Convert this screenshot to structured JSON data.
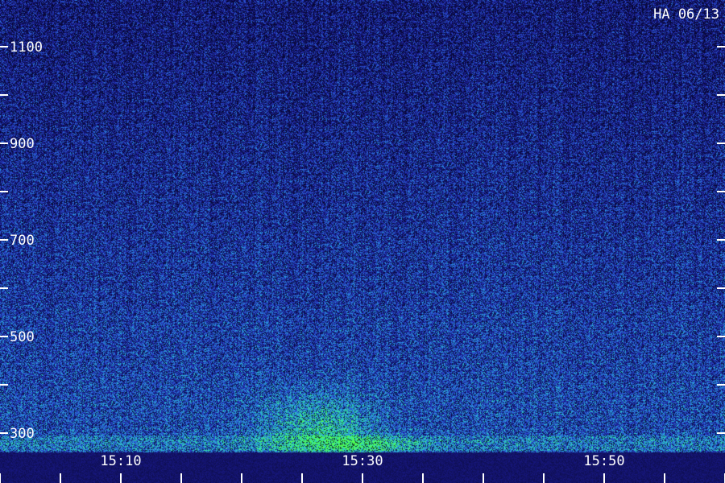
{
  "chart_data": {
    "type": "heatmap",
    "title": "HA 06/13",
    "yticks": [
      {
        "value": 300,
        "label": "300"
      },
      {
        "value": 500,
        "label": "500"
      },
      {
        "value": 700,
        "label": "700"
      },
      {
        "value": 900,
        "label": "900"
      },
      {
        "value": 1100,
        "label": "1100"
      }
    ],
    "yminor": [
      400,
      600,
      800,
      1000
    ],
    "xticks": [
      {
        "value": "15:10",
        "label": "15:10"
      },
      {
        "value": "15:30",
        "label": "15:30"
      },
      {
        "value": "15:50",
        "label": "15:50"
      }
    ],
    "xminor_count_between_labels": 3,
    "colormap": [
      "#0a0a3c",
      "#1a1a8c",
      "#2a4ad0",
      "#2a9ae0",
      "#30e0b0",
      "#50ff50"
    ],
    "intensity_summary": "low frequencies brighter; strongest emission near 15:25-15:35 below 350"
  }
}
